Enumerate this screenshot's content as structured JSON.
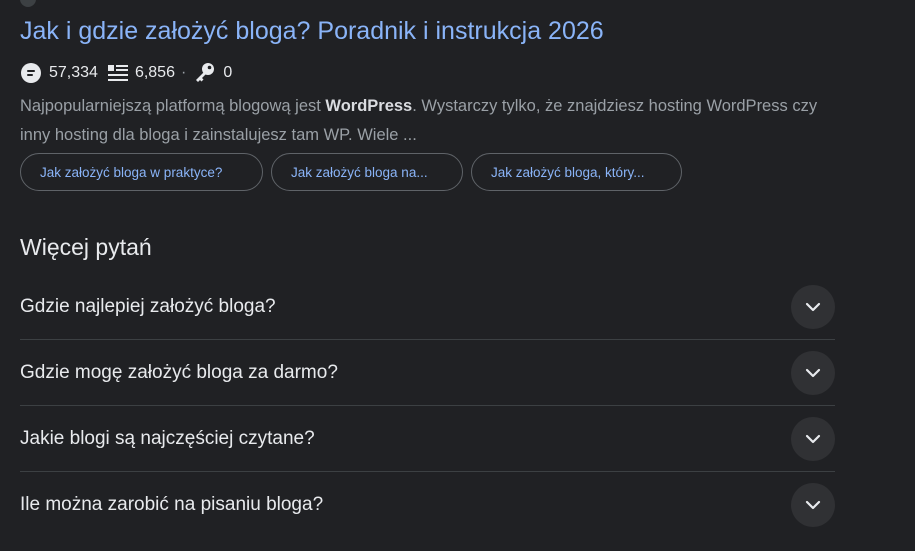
{
  "result": {
    "title": "Jak i gdzie założyć bloga? Poradnik i instrukcja 2026",
    "stats": {
      "comments": "57,334",
      "words": "6,856",
      "keys": "0",
      "separator": "·"
    },
    "snippet": {
      "before_bold": "Najpopularniejszą platformą blogową jest ",
      "bold": "WordPress",
      "after_bold": ". Wystarczy tylko, że znajdziesz hosting WordPress czy inny hosting dla bloga i zainstalujesz tam WP. Wiele ..."
    },
    "chips": [
      "Jak założyć bloga w praktyce?",
      "Jak założyć bloga na...",
      "Jak założyć bloga, który..."
    ],
    "icons": {
      "comments": "comment-bubble-icon",
      "words": "list-lines-icon",
      "keys": "key-icon",
      "expand": "chevron-down-icon"
    }
  },
  "more_questions": {
    "title": "Więcej pytań",
    "items": [
      "Gdzie najlepiej założyć bloga?",
      "Gdzie mogę założyć bloga za darmo?",
      "Jakie blogi są najczęściej czytane?",
      "Ile można zarobić na pisaniu bloga?"
    ]
  },
  "colors": {
    "background": "#202124",
    "link": "#8ab4f8",
    "text": "#e8eaed",
    "muted": "#9aa0a6",
    "divider": "#3c4043"
  }
}
